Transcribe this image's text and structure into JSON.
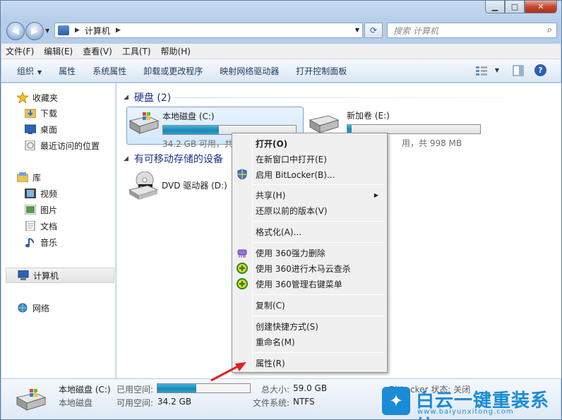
{
  "window": {
    "min": "▁",
    "max": "□",
    "close": "✕"
  },
  "address": {
    "crumb": "计算机",
    "search_placeholder": "搜索 计算机"
  },
  "menubar": [
    "文件(F)",
    "编辑(E)",
    "查看(V)",
    "工具(T)",
    "帮助(H)"
  ],
  "cmdbar": [
    "组织",
    "属性",
    "系统属性",
    "卸载或更改程序",
    "映射网络驱动器",
    "打开控制面板"
  ],
  "nav": {
    "favorites": "收藏夹",
    "downloads": "下载",
    "desktop": "桌面",
    "recent": "最近访问的位置",
    "libraries": "库",
    "videos": "视频",
    "pictures": "图片",
    "documents": "文档",
    "music": "音乐",
    "computer": "计算机",
    "network": "网络"
  },
  "content": {
    "hdd_group": "硬盘 (2)",
    "drive_c": {
      "name": "本地磁盘 (C:)",
      "free": "34.2 GB 可用，共",
      "fill": 0.42
    },
    "drive_e": {
      "name": "新加卷 (E:)",
      "free": "用，共 998 MB",
      "fill": 0.03
    },
    "removable_group": "有可移动存储的设备",
    "dvd": {
      "name": "DVD 驱动器 (D:)"
    }
  },
  "context_menu": [
    "打开(O)",
    "在新窗口中打开(E)",
    "启用 BitLocker(B)...",
    "共享(H)",
    "还原以前的版本(V)",
    "格式化(A)...",
    "使用 360强力删除",
    "使用 360进行木马云查杀",
    "使用 360管理右键菜单",
    "复制(C)",
    "创建快捷方式(S)",
    "重命名(M)",
    "属性(R)"
  ],
  "details": {
    "name": "本地磁盘 (C:)",
    "type": "本地磁盘",
    "used_label": "已用空间:",
    "free_label": "可用空间:",
    "free": "34.2 GB",
    "total_label": "总大小:",
    "total": "59.0 GB",
    "fs_label": "文件系统:",
    "fs": "NTFS",
    "bitlocker": "BitLocker 状态: 关闭",
    "fill": 0.42
  },
  "watermark": {
    "title": "白云一键重装系统",
    "url": "www.baiyunxitong.com"
  },
  "colors": {
    "accent": "#1a8bd6",
    "arrow": "#e02020"
  }
}
